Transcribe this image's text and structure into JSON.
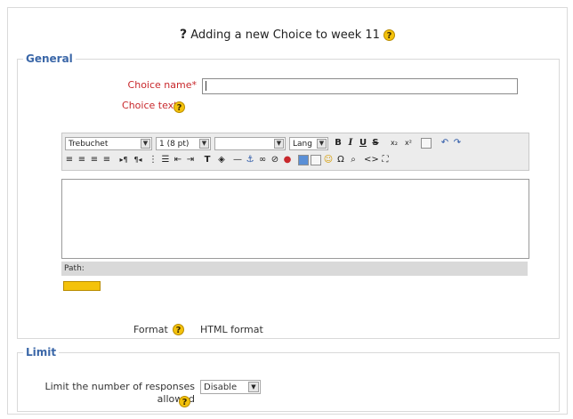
{
  "page_title": "Adding a new Choice to week 11",
  "general_legend": "General",
  "choice_name_label": "Choice name",
  "choice_name_value": "",
  "choice_text_label": "Choice text",
  "required_mark": "*",
  "toolbar": {
    "font_family": "Trebuchet",
    "font_size": "1 (8 pt)",
    "style": "",
    "lang": "Lang"
  },
  "path_label": "Path:",
  "format_label": "Format",
  "format_value": "HTML format",
  "limit_legend": "Limit",
  "limit_label": "Limit the number of responses allowed",
  "limit_value": "Disable",
  "help_glyph": "?",
  "title_glyph": "?"
}
